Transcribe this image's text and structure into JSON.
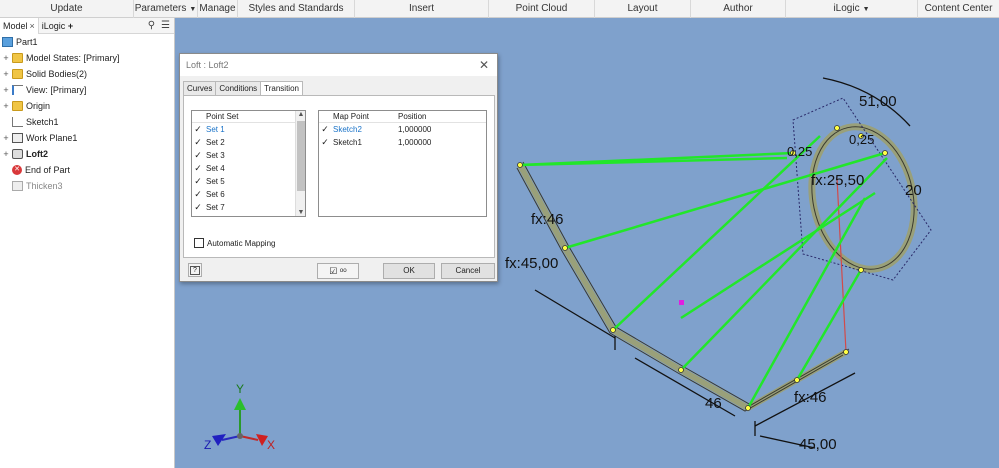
{
  "ribbon": {
    "tabs": [
      "Update",
      "Parameters",
      "Manage",
      "Styles and Standards",
      "Insert",
      "Point Cloud",
      "Layout",
      "Author",
      "iLogic",
      "Content Center"
    ]
  },
  "browser": {
    "tabs": [
      "Model",
      "iLogic"
    ],
    "close_glyph": "×",
    "add_glyph": "+",
    "tree": [
      {
        "label": "Part1",
        "icon": "part-icon",
        "expand": ""
      },
      {
        "label": "Model States: [Primary]",
        "icon": "folder-icon",
        "expand": "+"
      },
      {
        "label": "Solid Bodies(2)",
        "icon": "folder-icon",
        "expand": "+"
      },
      {
        "label": "View: [Primary]",
        "icon": "view-icon",
        "expand": "+"
      },
      {
        "label": "Origin",
        "icon": "folder-icon",
        "expand": "+"
      },
      {
        "label": "Sketch1",
        "icon": "sketch-icon",
        "expand": ""
      },
      {
        "label": "Work Plane1",
        "icon": "work-plane-icon",
        "expand": "+"
      },
      {
        "label": "Loft2",
        "icon": "loft-icon",
        "expand": "+"
      },
      {
        "label": "End of Part",
        "icon": "end-of-part-icon",
        "expand": ""
      },
      {
        "label": "Thicken3",
        "icon": "thicken-icon",
        "expand": ""
      }
    ]
  },
  "dialog": {
    "title": "Loft : Loft2",
    "close_glyph": "✕",
    "tabs": [
      "Curves",
      "Conditions",
      "Transition"
    ],
    "active_tab": "Transition",
    "point_set_header": "Point Set",
    "point_sets": [
      "Set 1",
      "Set 2",
      "Set 3",
      "Set 4",
      "Set 5",
      "Set 6",
      "Set 7"
    ],
    "map_header": "Map Point",
    "position_header": "Position",
    "map_rows": [
      {
        "map_point": "Sketch2",
        "position": "1,000000"
      },
      {
        "map_point": "Sketch1",
        "position": "1,000000"
      }
    ],
    "automatic_mapping": "Automatic Mapping",
    "ok": "OK",
    "cancel": "Cancel",
    "help_glyph": "?"
  },
  "viewport": {
    "dimensions": [
      "51,00",
      "0,25",
      "0,25",
      "fx:25,50",
      "20",
      "fx:46",
      "fx:45,00",
      "46",
      "fx:46",
      "45,00"
    ],
    "axis_labels": {
      "x": "X",
      "y": "Y",
      "z": "Z"
    }
  }
}
